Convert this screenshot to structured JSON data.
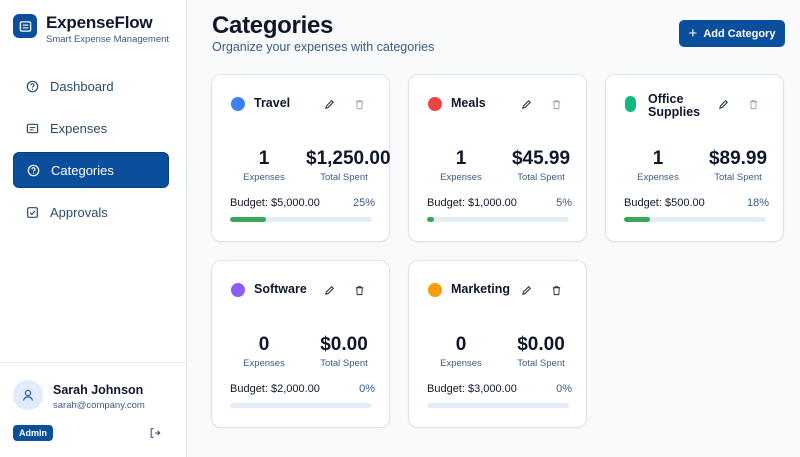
{
  "brand": {
    "name": "ExpenseFlow",
    "tagline": "Smart Expense Management"
  },
  "nav": [
    {
      "label": "Dashboard",
      "icon": "help-circle-icon",
      "active": false
    },
    {
      "label": "Expenses",
      "icon": "receipt-icon",
      "active": false
    },
    {
      "label": "Categories",
      "icon": "help-circle-icon",
      "active": true
    },
    {
      "label": "Approvals",
      "icon": "checkbox-icon",
      "active": false
    }
  ],
  "user": {
    "name": "Sarah Johnson",
    "email": "sarah@company.com",
    "role": "Admin"
  },
  "header": {
    "title": "Categories",
    "subtitle": "Organize your expenses with categories",
    "add_label": "Add Category"
  },
  "colors": {
    "primary": "#0b4e9c",
    "progress": "#3aa657",
    "track": "#e3edf8"
  },
  "categories": [
    {
      "name": "Travel",
      "color": "#3b82f6",
      "expenses": "1",
      "expenses_label": "Expenses",
      "spent": "$1,250.00",
      "spent_label": "Total Spent",
      "budget": "Budget: $5,000.00",
      "percent": "25%",
      "progress": 25
    },
    {
      "name": "Meals",
      "color": "#ef4444",
      "expenses": "1",
      "expenses_label": "Expenses",
      "spent": "$45.99",
      "spent_label": "Total Spent",
      "budget": "Budget: $1,000.00",
      "percent": "5%",
      "progress": 5
    },
    {
      "name": "Office Supplies",
      "color": "#10b981",
      "expenses": "1",
      "expenses_label": "Expenses",
      "spent": "$89.99",
      "spent_label": "Total Spent",
      "budget": "Budget: $500.00",
      "percent": "18%",
      "progress": 18
    },
    {
      "name": "Software",
      "color": "#8b5cf6",
      "expenses": "0",
      "expenses_label": "Expenses",
      "spent": "$0.00",
      "spent_label": "Total Spent",
      "budget": "Budget: $2,000.00",
      "percent": "0%",
      "progress": 0
    },
    {
      "name": "Marketing",
      "color": "#f59e0b",
      "expenses": "0",
      "expenses_label": "Expenses",
      "spent": "$0.00",
      "spent_label": "Total Spent",
      "budget": "Budget: $3,000.00",
      "percent": "0%",
      "progress": 0
    }
  ]
}
